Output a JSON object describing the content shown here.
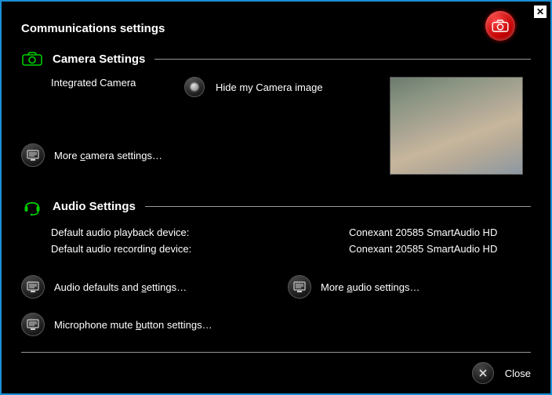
{
  "title": "Communications settings",
  "camera": {
    "section_title": "Camera Settings",
    "device_name": "Integrated Camera",
    "hide_label": "Hide my Camera image",
    "more_label_pre": "More ",
    "more_label_u": "c",
    "more_label_post": "amera settings…"
  },
  "audio": {
    "section_title": "Audio Settings",
    "playback_label": "Default audio playback device:",
    "playback_value": "Conexant 20585 SmartAudio HD",
    "recording_label": "Default audio recording device:",
    "recording_value": "Conexant 20585 SmartAudio HD",
    "defaults_label_pre": "Audio defaults and ",
    "defaults_label_u": "s",
    "defaults_label_post": "ettings…",
    "more_label_pre": "More ",
    "more_label_u": "a",
    "more_label_post": "udio settings…",
    "mic_label_pre": "Microphone mute ",
    "mic_label_u": "b",
    "mic_label_post": "utton settings…"
  },
  "footer": {
    "close_label": "Close"
  }
}
